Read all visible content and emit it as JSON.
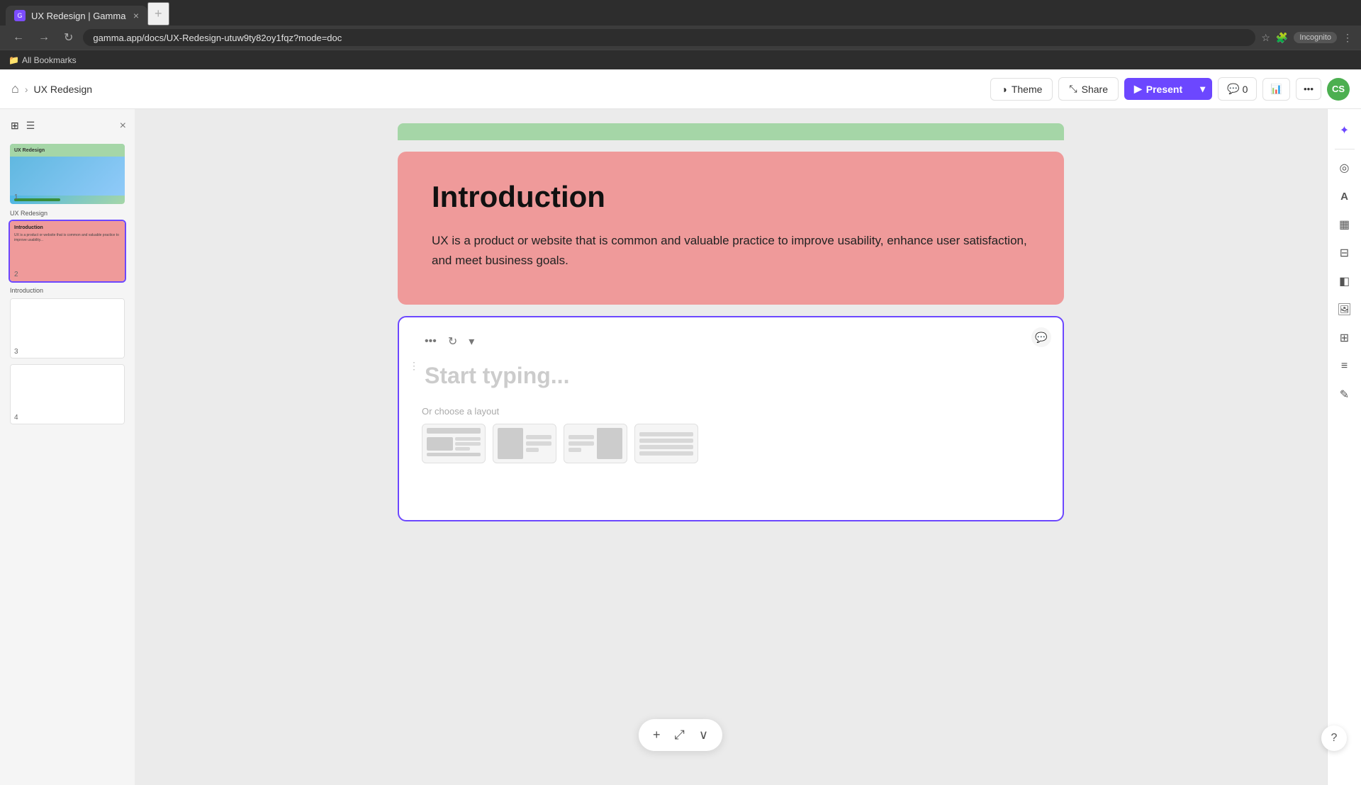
{
  "browser": {
    "tab_title": "UX Redesign | Gamma",
    "tab_favicon": "G",
    "url": "gamma.app/docs/UX-Redesign-utuw9ty82oy1fqz?mode=doc",
    "incognito_label": "Incognito",
    "bookmarks_label": "All Bookmarks"
  },
  "topbar": {
    "home_icon": "⌂",
    "breadcrumb_sep": "›",
    "breadcrumb": "UX Redesign",
    "theme_label": "Theme",
    "share_label": "Share",
    "present_label": "Present",
    "comment_count": "0",
    "avatar_initials": "CS"
  },
  "sidebar": {
    "close_icon": "×",
    "slides": [
      {
        "id": 1,
        "label": "UX Redesign"
      },
      {
        "id": 2,
        "label": "Introduction"
      },
      {
        "id": 3,
        "label": ""
      },
      {
        "id": 4,
        "label": ""
      }
    ]
  },
  "intro_card": {
    "title": "Introduction",
    "body": "UX is a product or website that is common and valuable practice to improve usability, enhance user satisfaction, and meet business goals."
  },
  "new_slide": {
    "placeholder": "Start typing...",
    "layout_label": "Or choose a layout"
  },
  "bottom_toolbar": {
    "add_icon": "+",
    "expand_icon": "⤢",
    "chevron_icon": "∨"
  },
  "right_panel": {
    "ai_icon": "✦",
    "style_icon": "◎",
    "text_icon": "A",
    "layout_icon": "▦",
    "blocks_icon": "⊟",
    "layers_icon": "◧",
    "image_icon": "🖼",
    "grid_icon": "⊞",
    "lines_icon": "≡",
    "edit_icon": "✎"
  },
  "help_btn": "?"
}
